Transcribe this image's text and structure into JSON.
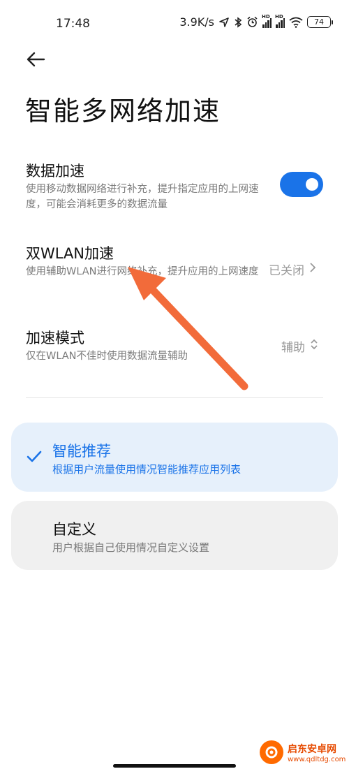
{
  "status_bar": {
    "time": "17:48",
    "net_speed": "3.9K/s",
    "battery": "74",
    "icons": [
      "location-icon",
      "bluetooth-icon",
      "alarm-icon",
      "signal-hd-icon",
      "signal-hd-icon",
      "wifi-icon",
      "battery-icon"
    ]
  },
  "header": {
    "title": "智能多网络加速"
  },
  "settings": {
    "data_accel": {
      "title": "数据加速",
      "desc": "使用移动数据网络进行补充，提升指定应用的上网速度，可能会消耗更多的数据流量",
      "enabled": true
    },
    "dual_wlan": {
      "title": "双WLAN加速",
      "desc": "使用辅助WLAN进行网络补充，提升应用的上网速度",
      "value": "已关闭"
    },
    "accel_mode": {
      "title": "加速模式",
      "desc": "仅在WLAN不佳时使用数据流量辅助",
      "value": "辅助"
    }
  },
  "options": [
    {
      "title": "智能推荐",
      "desc": "根据用户流量使用情况智能推荐应用列表",
      "selected": true
    },
    {
      "title": "自定义",
      "desc": "用户根据自己使用情况自定义设置",
      "selected": false
    }
  ],
  "watermark": {
    "name": "启东安卓网",
    "url": "www.qdltdg.com"
  },
  "colors": {
    "accent": "#1a73e8",
    "selected_card": "#e6f0fb",
    "card": "#f0f0f0",
    "annotation": "#f26b3a"
  }
}
